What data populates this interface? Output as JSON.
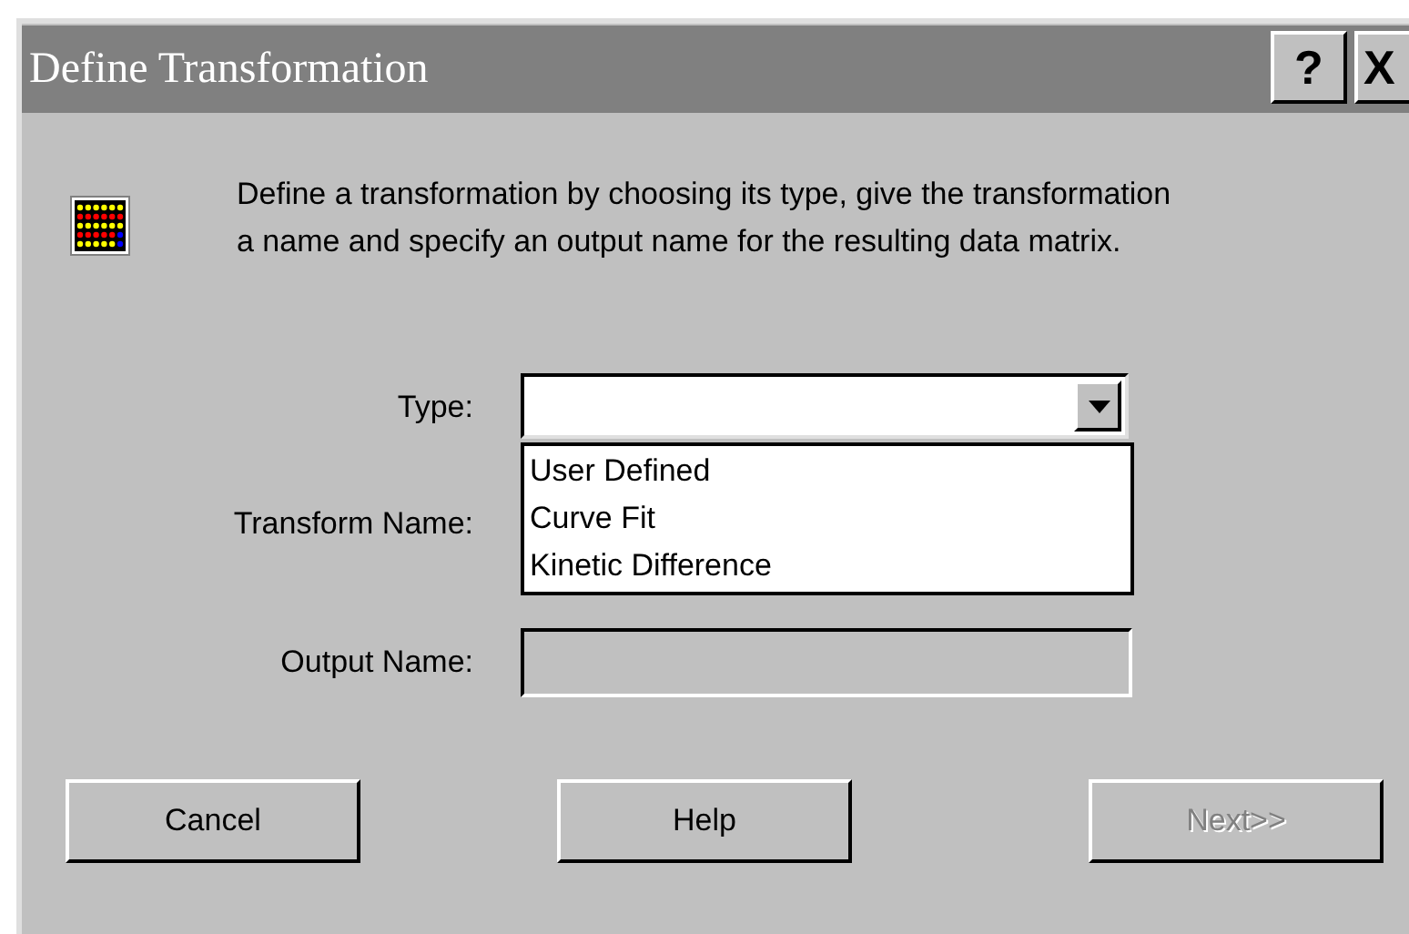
{
  "window": {
    "title": "Define Transformation",
    "title_buttons": [
      {
        "kind": "help",
        "label": "?"
      },
      {
        "kind": "close",
        "label": "X"
      }
    ]
  },
  "intro": {
    "text": "Define a transformation by choosing its type, give the transformation a name and specify an output name for the resulting data matrix."
  },
  "fields": [
    {
      "label": "Type:",
      "kind": "combo",
      "open": true,
      "options": [
        "User Defined",
        "Curve Fit",
        "Kinetic Difference"
      ]
    },
    {
      "label": "Transform Name:",
      "kind": "covered"
    },
    {
      "label": "Output Name:",
      "kind": "text",
      "disabled": true
    }
  ],
  "buttons": [
    {
      "label": "Cancel",
      "disabled": false
    },
    {
      "label": "Help",
      "disabled": false
    },
    {
      "label": "Next>>",
      "disabled": true
    }
  ]
}
